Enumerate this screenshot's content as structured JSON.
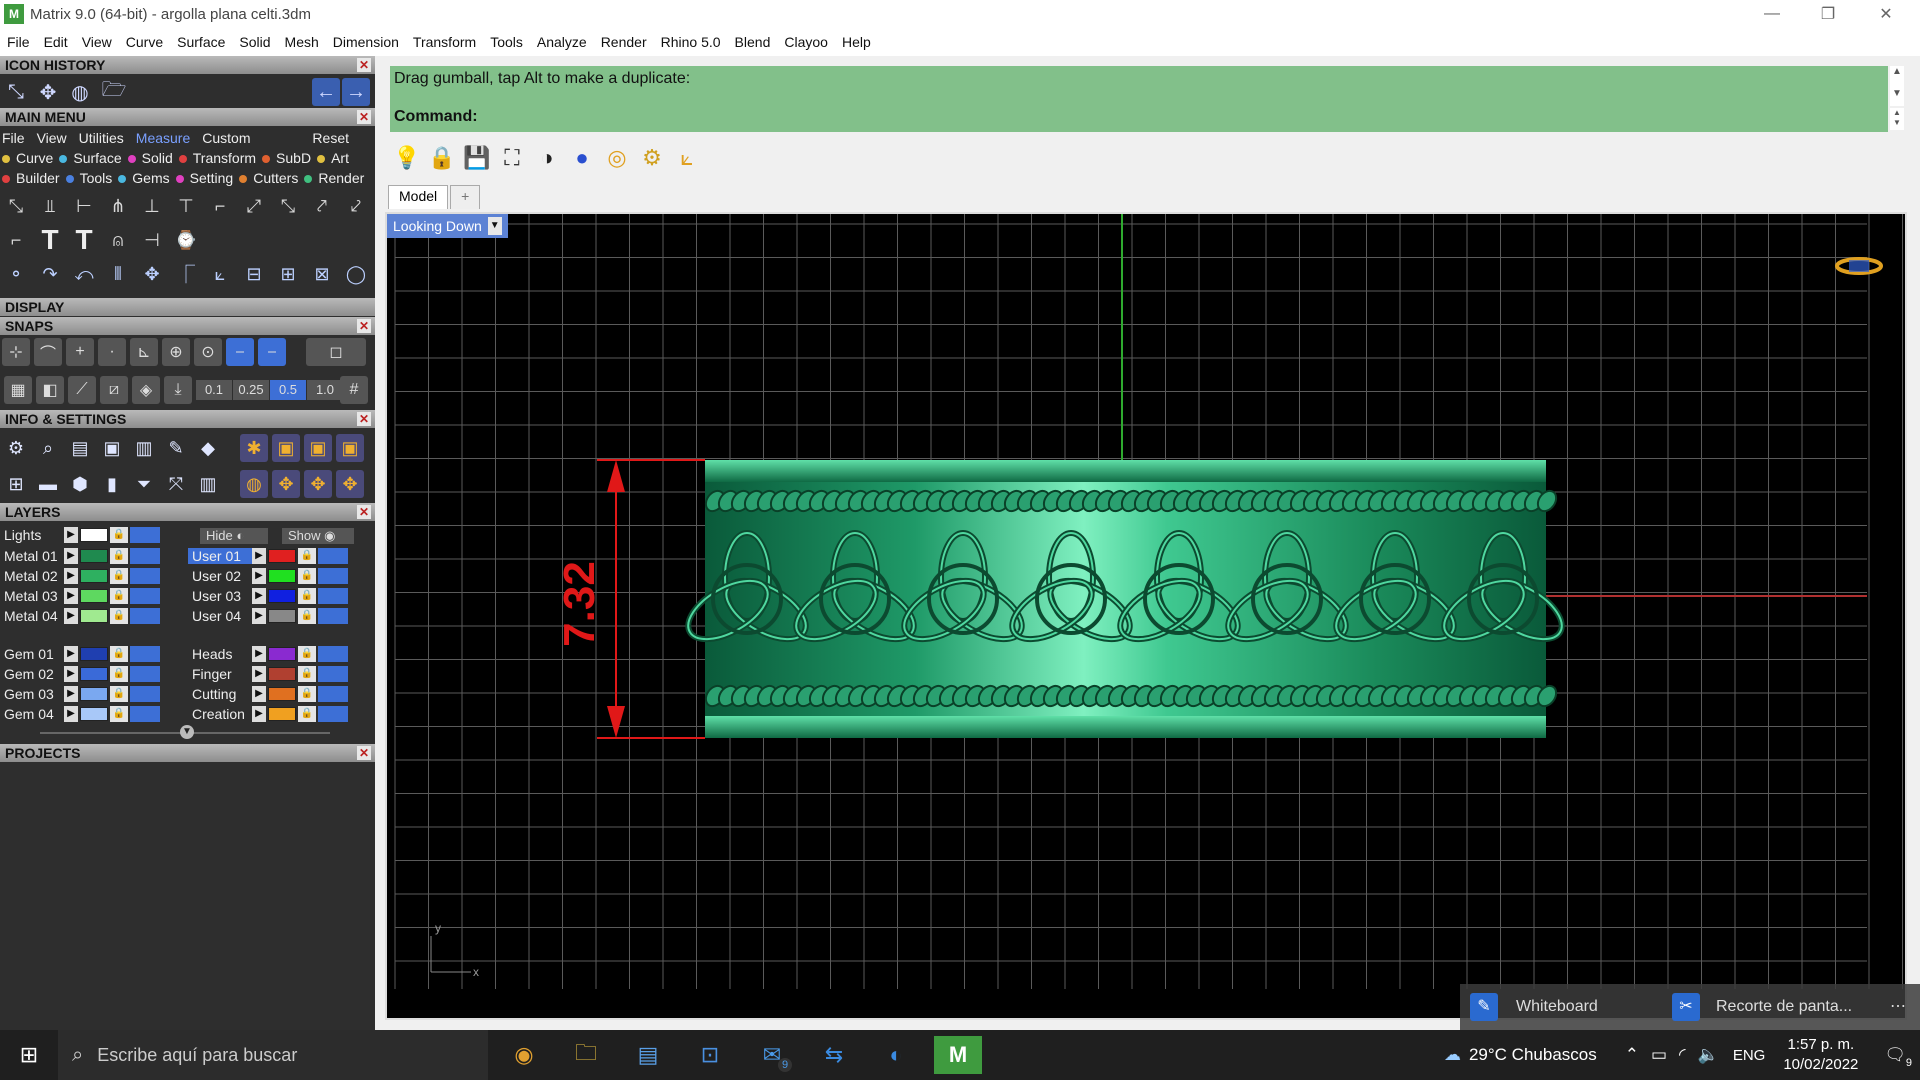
{
  "window": {
    "title": "Matrix 9.0 (64-bit) - argolla plana celti.3dm",
    "minimize": "—",
    "restore": "❐",
    "close": "✕"
  },
  "menubar": {
    "items": [
      "File",
      "Edit",
      "View",
      "Curve",
      "Surface",
      "Solid",
      "Mesh",
      "Dimension",
      "Transform",
      "Tools",
      "Analyze",
      "Render",
      "Rhino 5.0",
      "Blend",
      "Clayoo",
      "Help"
    ]
  },
  "panel": {
    "icon_history": "ICON HISTORY",
    "main_menu": "MAIN MENU",
    "display": "DISPLAY",
    "snaps": "SNAPS",
    "info_settings": "INFO & SETTINGS",
    "layers": "LAYERS",
    "projects": "PROJECTS",
    "mm_tabs": [
      "File",
      "View",
      "Utilities",
      "Measure",
      "Custom"
    ],
    "mm_reset": "Reset",
    "cats_row1": [
      {
        "label": "Curve",
        "color": "#e0c040"
      },
      {
        "label": "Surface",
        "color": "#4ab8e0"
      },
      {
        "label": "Solid",
        "color": "#e040c0"
      },
      {
        "label": "Transform",
        "color": "#e04040"
      },
      {
        "label": "SubD",
        "color": "#e06030"
      },
      {
        "label": "Art",
        "color": "#e0c040"
      }
    ],
    "cats_row2": [
      {
        "label": "Builder",
        "color": "#e04040"
      },
      {
        "label": "Tools",
        "color": "#4a80e0"
      },
      {
        "label": "Gems",
        "color": "#4ab8e0"
      },
      {
        "label": "Setting",
        "color": "#e040c0"
      },
      {
        "label": "Cutters",
        "color": "#e08030"
      },
      {
        "label": "Render",
        "color": "#40c080"
      }
    ],
    "snap_values": [
      "0.1",
      "0.25",
      "0.5",
      "1.0"
    ],
    "lights": "Lights",
    "hide": "Hide",
    "show": "Show",
    "layers_left": [
      {
        "name": "Metal 01",
        "color": "#1f8a4f"
      },
      {
        "name": "Metal 02",
        "color": "#2eb060"
      },
      {
        "name": "Metal 03",
        "color": "#5ed860"
      },
      {
        "name": "Metal 04",
        "color": "#a0ea90"
      },
      {
        "name": "Gem 01",
        "color": "#1f3fb0"
      },
      {
        "name": "Gem 02",
        "color": "#3a6ad8"
      },
      {
        "name": "Gem 03",
        "color": "#7aa8f0"
      },
      {
        "name": "Gem 04",
        "color": "#a8c8f8"
      }
    ],
    "layers_right": [
      {
        "name": "User 01",
        "color": "#e02020"
      },
      {
        "name": "User 02",
        "color": "#20e020"
      },
      {
        "name": "User 03",
        "color": "#1020e0"
      },
      {
        "name": "User 04",
        "color": "#888888"
      },
      {
        "name": "Heads",
        "color": "#8a2ad0"
      },
      {
        "name": "Finger",
        "color": "#b04030"
      },
      {
        "name": "Cutting",
        "color": "#e07020"
      },
      {
        "name": "Creation",
        "color": "#f0a020"
      }
    ]
  },
  "command": {
    "message": "Drag gumball, tap Alt to make a duplicate:",
    "label": "Command:"
  },
  "viewport": {
    "tabs": [
      "Model",
      "+"
    ],
    "label": "Looking Down",
    "dimension": "7.32",
    "axis_y": "y",
    "axis_x": "x"
  },
  "taskbar": {
    "search_placeholder": "Escribe aquí para buscar",
    "mail_badge": "9",
    "weather": "29°C  Chubascos",
    "lang": "ENG",
    "time": "1:57 p. m.",
    "date": "10/02/2022",
    "notif_badge": "9"
  },
  "notifications": {
    "whiteboard": "Whiteboard",
    "snip": "Recorte de panta...",
    "more": "⋯"
  }
}
